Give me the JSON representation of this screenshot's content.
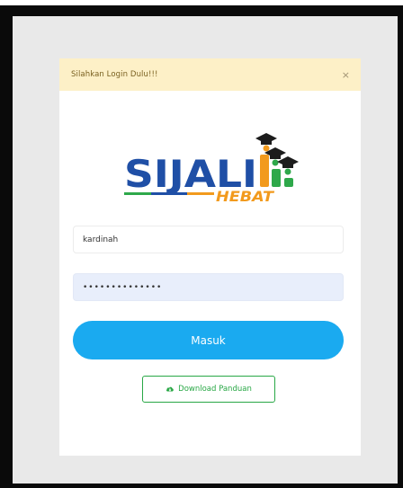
{
  "alert": {
    "message": "Silahkan Login Dulu!!!",
    "close_glyph": "×"
  },
  "logo": {
    "main_text": "SIJALI",
    "sub_text": "HEBAT",
    "colors": {
      "primary_blue": "#1f4fa6",
      "accent_orange": "#f29a1d",
      "accent_green": "#2ea84a",
      "cap_black": "#1c1c1c"
    }
  },
  "form": {
    "username_value": "kardinah",
    "password_value": "••••••••••••••",
    "submit_label": "Masuk"
  },
  "download": {
    "label": "Download Panduan",
    "icon": "cloud-download-icon"
  },
  "theme": {
    "primary_button": "#1aaaf0",
    "success": "#28a745",
    "alert_bg": "#fdf0c7"
  }
}
